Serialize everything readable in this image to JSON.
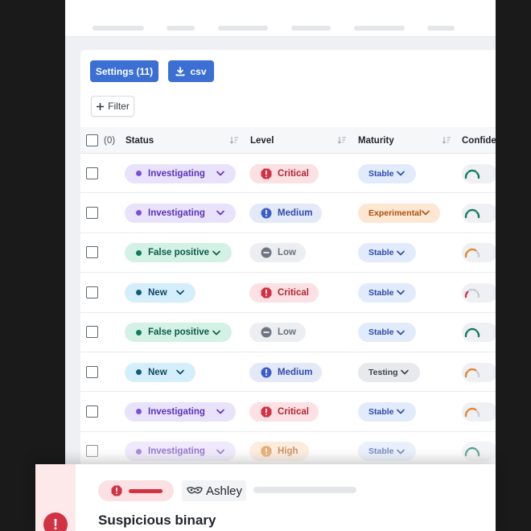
{
  "toolbar": {
    "settings_label": "Settings (11)",
    "csv_label": "csv",
    "filter_label": "Filter"
  },
  "table": {
    "selected_count": "(0)",
    "columns": [
      "Status",
      "Level",
      "Maturity",
      "Confider"
    ],
    "rows": [
      {
        "status": "Investigating",
        "level": "Critical",
        "maturity": "Stable",
        "confidence": "high"
      },
      {
        "status": "Investigating",
        "level": "Medium",
        "maturity": "Experimental",
        "confidence": "high"
      },
      {
        "status": "False positive",
        "level": "Low",
        "maturity": "Stable",
        "confidence": "medium"
      },
      {
        "status": "New",
        "level": "Critical",
        "maturity": "Stable",
        "confidence": "low"
      },
      {
        "status": "False positive",
        "level": "Low",
        "maturity": "Stable",
        "confidence": "high"
      },
      {
        "status": "New",
        "level": "Medium",
        "maturity": "Testing",
        "confidence": "medium"
      },
      {
        "status": "Investigating",
        "level": "Critical",
        "maturity": "Stable",
        "confidence": "medium"
      },
      {
        "status": "Investigating",
        "level": "High",
        "maturity": "Stable",
        "confidence": "high"
      }
    ]
  },
  "alert": {
    "user": "Ashley",
    "title": "Suspicious binary"
  },
  "colors": {
    "primary": "#3b6fd4",
    "investigating": "#7b4fd6",
    "false_positive": "#0f7b5f",
    "new": "#0f5d7a",
    "critical": "#d23344",
    "medium": "#3b5fc7",
    "low": "#6f7682",
    "high": "#e2862f"
  }
}
